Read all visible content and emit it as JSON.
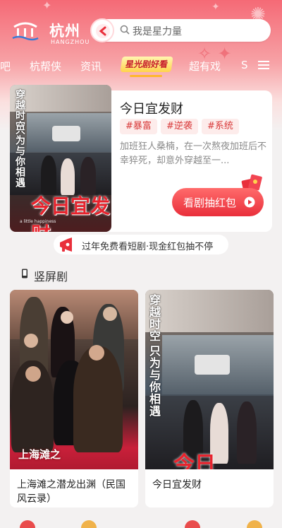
{
  "app": {
    "logo_cn": "杭州",
    "logo_en": "HANGZHOU"
  },
  "search": {
    "placeholder": "我是星力量"
  },
  "tabs": [
    {
      "label": "吧"
    },
    {
      "label": "杭帮侠"
    },
    {
      "label": "资讯"
    },
    {
      "label": "星光剧好看",
      "active": true
    },
    {
      "label": "超有戏"
    },
    {
      "label": "S"
    }
  ],
  "feature": {
    "title": "今日宜发财",
    "tags": [
      "#暴富",
      "#逆袭",
      "#系统"
    ],
    "description": "加班狂人桑楠，在一次熬夜加班后不幸猝死，却意外穿越至一...",
    "button": "看剧抽红包",
    "poster": {
      "vertical_text_1": "穿越时空",
      "vertical_text_2": "只为与你相遇",
      "title": "今日宜发财",
      "subtitle": "a little happiness"
    }
  },
  "promo": {
    "text": "过年免费看短剧·现金红包抽不停"
  },
  "section": {
    "title": "竖屏剧"
  },
  "cards": [
    {
      "title": "上海滩之潜龙出渊（民国风云录）",
      "poster_text": "上海滩之"
    },
    {
      "title": "今日宜发财",
      "poster_vertical_1": "穿越时空",
      "poster_vertical_2": "只为与你相遇",
      "poster_title": "今日"
    }
  ],
  "colors": {
    "brand_red": "#e92f3b",
    "tag_bg": "#fdeceb",
    "header_top": "#f56a76"
  }
}
